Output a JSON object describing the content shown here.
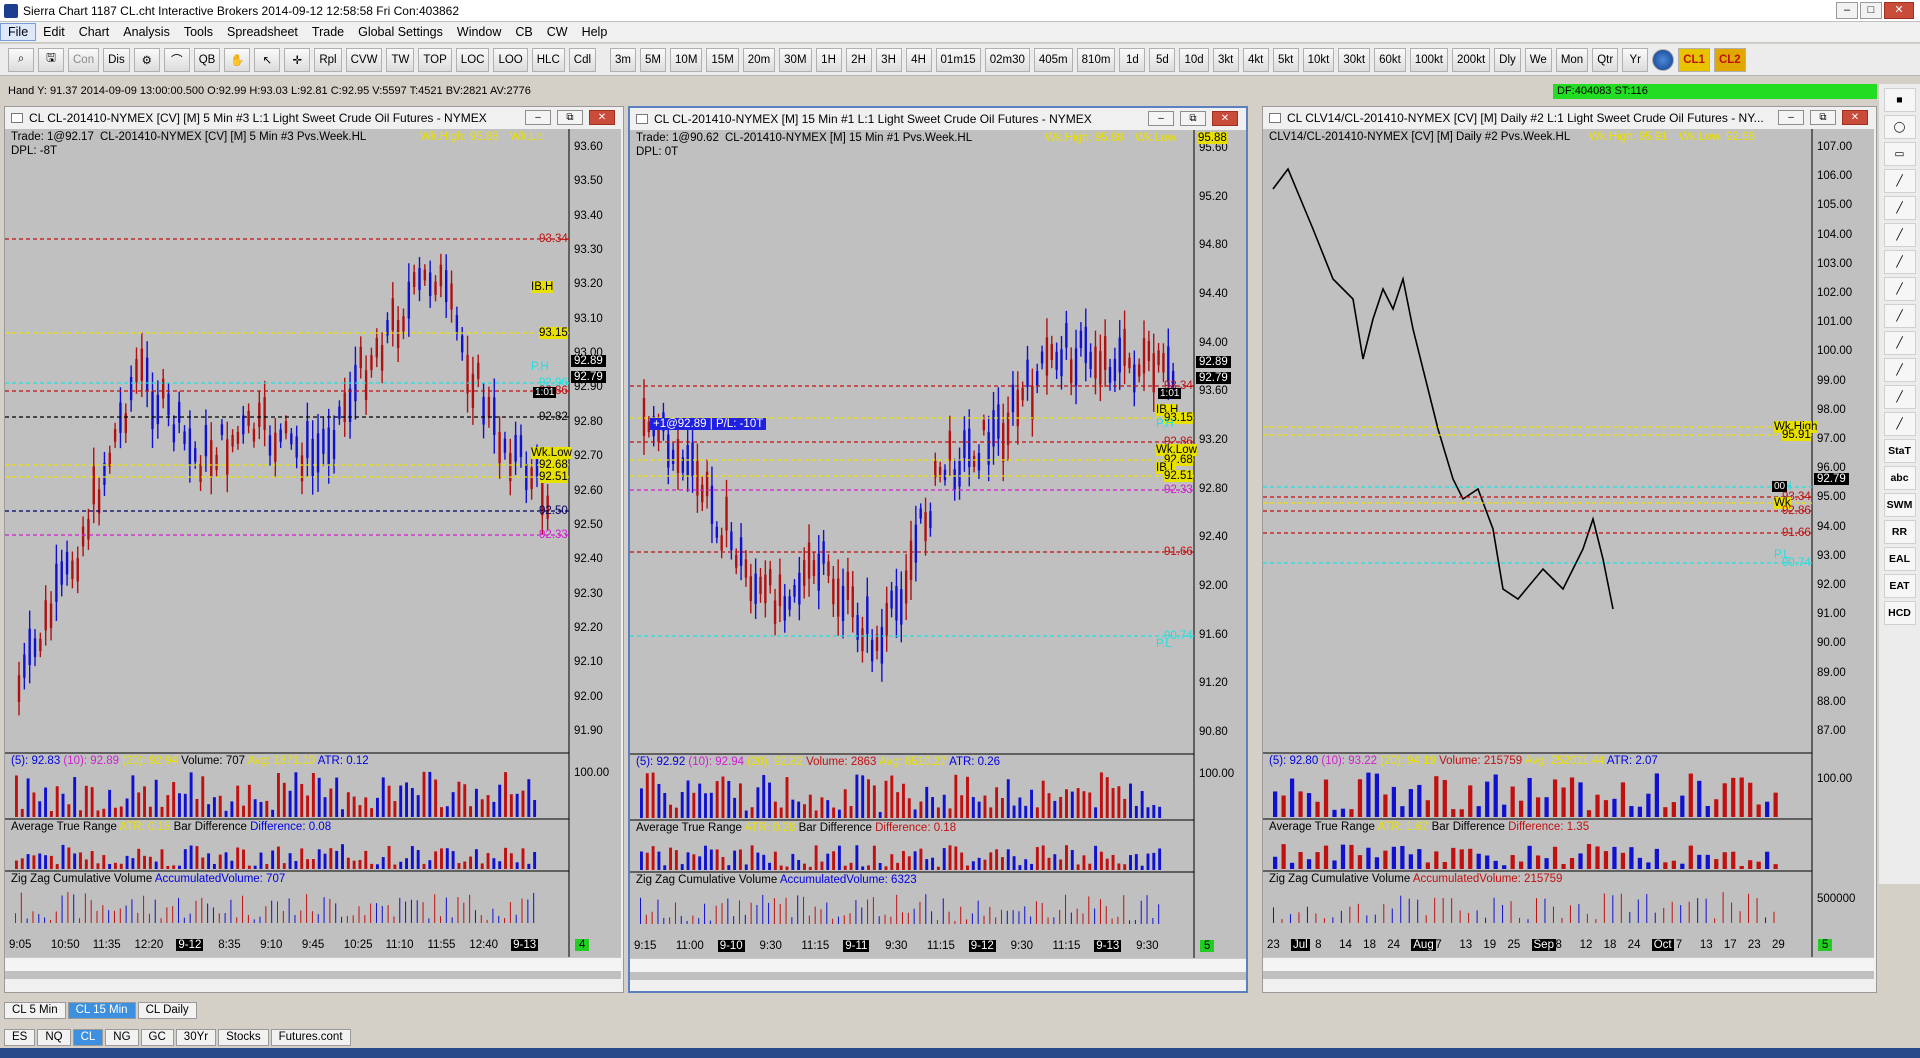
{
  "window": {
    "title": "Sierra Chart 1187 CL.cht  Interactive Brokers 2014-09-12  12:58:58 Fri  Con:403862"
  },
  "menu": [
    "File",
    "Edit",
    "Chart",
    "Analysis",
    "Tools",
    "Spreadsheet",
    "Trade",
    "Global Settings",
    "Window",
    "CB",
    "CW",
    "Help"
  ],
  "toolbar": {
    "left": [
      "Con",
      "Dis",
      "QB",
      "Rpl",
      "CVW",
      "TW",
      "TOP",
      "LOC",
      "LOO",
      "HLC",
      "Cdl"
    ],
    "periods": [
      "3m",
      "5M",
      "10M",
      "15M",
      "20m",
      "30M",
      "1H",
      "2H",
      "3H",
      "4H",
      "01m15",
      "02m30",
      "405m",
      "810m",
      "1d",
      "5d",
      "10d",
      "3kt",
      "4kt",
      "5kt",
      "10kt",
      "30kt",
      "60kt",
      "100kt",
      "200kt",
      "Dly",
      "We",
      "Mon",
      "Qtr",
      "Yr"
    ],
    "cl1": "CL1",
    "cl2": "CL2"
  },
  "status_line": "Hand Y: 91.37  2014-09-09  13:00:00.500  O:92.99  H:93.03  L:92.81  C:92.95  V:5597  T:4521  BV:2821  AV:2776",
  "df_box": "DF:404083  ST:116",
  "charts": [
    {
      "id": "c1",
      "win_title": "CL  CL-201410-NYMEX [CV] [M]  5 Min  #3  L:1  Light Sweet Crude Oil Futures - NYMEX",
      "header": "CL-201410-NYMEX [CV] [M]  5 Min  #3  Pvs.Week.HL",
      "trade": "Trade: 1@92.17",
      "dpl": "DPL: -8T",
      "wkhigh": "Wk.High: 95.88",
      "wklow_hdr": "Wk.Lo",
      "price_axis": [
        "93.60",
        "93.50",
        "93.40",
        "93.30",
        "93.20",
        "93.10",
        "93.00",
        "92.90",
        "92.80",
        "92.70",
        "92.60",
        "92.50",
        "92.40",
        "92.30",
        "92.20",
        "92.10",
        "92.00",
        "91.90"
      ],
      "levels": [
        {
          "t": "93.34",
          "c": "#c01010"
        },
        {
          "t": "IB.H",
          "c": "#e8e000"
        },
        {
          "t": "93.15",
          "c": "#e8e000"
        },
        {
          "t": "P.H",
          "c": "#20e0e0"
        },
        {
          "t": "92.96",
          "c": "#20e0e0"
        },
        {
          "t": "92.86",
          "c": "#c01010"
        },
        {
          "t": "92.82",
          "c": "#000"
        },
        {
          "t": "Wk.Low",
          "c": "#e8e000"
        },
        {
          "t": "92.68",
          "c": "#e8e000"
        },
        {
          "t": "92.51",
          "c": "#e8e000"
        },
        {
          "t": "92.50",
          "c": "#000060"
        },
        {
          "t": "92.33",
          "c": "#d020d0"
        }
      ],
      "price_boxes": [
        "92.89",
        "92.79"
      ],
      "timer": "1:01",
      "study1": [
        {
          "t": "(5): 92.83",
          "c": "#0000e0"
        },
        {
          "t": "(10): 92.89",
          "c": "#d020d0"
        },
        {
          "t": "(20): 92.94",
          "c": "#e8e000"
        },
        {
          "t": "Volume: 707",
          "c": "#000"
        },
        {
          "t": "Avg: 1871.10",
          "c": "#e8e000"
        },
        {
          "t": "ATR: 0.12",
          "c": "#0000e0"
        }
      ],
      "vol_axis": "100.00",
      "study2": [
        {
          "t": "Average True Range",
          "c": "#000"
        },
        {
          "t": "ATR: 0.15",
          "c": "#e8e000"
        },
        {
          "t": "Bar Difference",
          "c": "#000"
        },
        {
          "t": "Difference: 0.08",
          "c": "#0000e0"
        }
      ],
      "study3": [
        {
          "t": "Zig Zag Cumulative Volume",
          "c": "#000"
        },
        {
          "t": "AccumulatedVolume: 707",
          "c": "#0000e0"
        }
      ],
      "time_axis": [
        "9:05",
        "10:50",
        "11:35",
        "12:20",
        "9-12",
        "8:35",
        "9:10",
        "9:45",
        "10:25",
        "11:10",
        "11:55",
        "12:40",
        "9-13"
      ],
      "corner": "4"
    },
    {
      "id": "c2",
      "win_title": "CL  CL-201410-NYMEX [M]  15 Min  #1  L:1  Light Sweet Crude Oil Futures - NYMEX",
      "header": "CL-201410-NYMEX [M]  15 Min  #1  Pvs.Week.HL",
      "trade": "Trade: 1@90.62",
      "dpl": "DPL: 0T",
      "wkhigh": "Wk.High: 95.88",
      "wklow_hdr": "Wk.Low:",
      "wklow_val": "95.88",
      "price_axis": [
        "95.60",
        "95.20",
        "94.80",
        "94.40",
        "94.00",
        "93.60",
        "93.20",
        "92.80",
        "92.40",
        "92.00",
        "91.60",
        "91.20",
        "90.80"
      ],
      "levels": [
        {
          "t": "93.34",
          "c": "#c01010"
        },
        {
          "t": "IB.H",
          "c": "#e8e000"
        },
        {
          "t": "93.15",
          "c": "#e8e000"
        },
        {
          "t": "P.H",
          "c": "#20e0e0"
        },
        {
          "t": "92.86",
          "c": "#c01010"
        },
        {
          "t": "Wk.Low",
          "c": "#e8e000"
        },
        {
          "t": "92.68",
          "c": "#e8e000"
        },
        {
          "t": "IB.L",
          "c": "#e8e000"
        },
        {
          "t": "92.51",
          "c": "#e8e000"
        },
        {
          "t": "92.33",
          "c": "#d020d0"
        },
        {
          "t": "91.66",
          "c": "#c01010"
        },
        {
          "t": "P.L",
          "c": "#20e0e0"
        },
        {
          "t": "90.74",
          "c": "#20e0e0"
        }
      ],
      "price_boxes": [
        "92.89",
        "92.79"
      ],
      "timer": "1:01",
      "position_label": "+1@92.89 | P/L: -10T",
      "study1": [
        {
          "t": "(5): 92.92",
          "c": "#0000e0"
        },
        {
          "t": "(10): 92.94",
          "c": "#d020d0"
        },
        {
          "t": "(20): 92.82",
          "c": "#e8e000"
        },
        {
          "t": "Volume: 2863",
          "c": "#c01010"
        },
        {
          "t": "Avg: 6510.27",
          "c": "#e8e000"
        },
        {
          "t": "ATR: 0.26",
          "c": "#0000e0"
        }
      ],
      "vol_axis": "100.00",
      "study2": [
        {
          "t": "Average True Range",
          "c": "#000"
        },
        {
          "t": "ATR: 0.28",
          "c": "#e8e000"
        },
        {
          "t": "Bar Difference",
          "c": "#000"
        },
        {
          "t": "Difference: 0.18",
          "c": "#c01010"
        }
      ],
      "study3": [
        {
          "t": "Zig Zag Cumulative Volume",
          "c": "#000"
        },
        {
          "t": "AccumulatedVolume: 6323",
          "c": "#0000e0"
        }
      ],
      "time_axis": [
        "9:15",
        "11:00",
        "9-10",
        "9:30",
        "11:15",
        "9-11",
        "9:30",
        "11:15",
        "9-12",
        "9:30",
        "11:15",
        "9-13",
        "9:30"
      ],
      "corner": "5"
    },
    {
      "id": "c3",
      "win_title": "CL  CLV14/CL-201410-NYMEX [CV] [M]  Daily  #2  L:1  Light Sweet Crude Oil Futures - NY...",
      "header": "CLV14/CL-201410-NYMEX [CV] [M]  Daily  #2  Pvs.Week.HL",
      "wkhigh": "Wk.High: 95.91",
      "wklow_hdr": "Wk.Low: 92.68",
      "price_axis": [
        "107.00",
        "106.00",
        "105.00",
        "104.00",
        "103.00",
        "102.00",
        "101.00",
        "100.00",
        "99.00",
        "98.00",
        "97.00",
        "96.00",
        "95.00",
        "94.00",
        "93.00",
        "92.00",
        "91.00",
        "90.00",
        "89.00",
        "88.00",
        "87.00"
      ],
      "levels": [
        {
          "t": "Wk.High",
          "c": "#e8e000"
        },
        {
          "t": "95.91",
          "c": "#e8e000"
        },
        {
          "t": "P.H",
          "c": "#20e0e0"
        },
        {
          "t": "93.34",
          "c": "#c01010"
        },
        {
          "t": "Wk",
          "c": "#e8e000"
        },
        {
          "t": "92.86",
          "c": "#c01010"
        },
        {
          "t": "91.66",
          "c": "#c01010"
        },
        {
          "t": "P.L",
          "c": "#20e0e0"
        },
        {
          "t": "90.74",
          "c": "#20e0e0"
        }
      ],
      "price_boxes": [
        "92.79"
      ],
      "timer": "00",
      "study1": [
        {
          "t": "(5): 92.80",
          "c": "#0000e0"
        },
        {
          "t": "(10): 93.22",
          "c": "#d020d0"
        },
        {
          "t": "(20): 94.19",
          "c": "#e8e000"
        },
        {
          "t": "Volume: 215759",
          "c": "#c01010"
        },
        {
          "t": "Avg: 252011.44",
          "c": "#e8e000"
        },
        {
          "t": "ATR: 2.07",
          "c": "#0000e0"
        }
      ],
      "vol_axis": "100.00",
      "vol_axis2": "500000",
      "study2": [
        {
          "t": "Average True Range",
          "c": "#000"
        },
        {
          "t": "ATR: 1.67",
          "c": "#e8e000"
        },
        {
          "t": "Bar Difference",
          "c": "#000"
        },
        {
          "t": "Difference: 1.35",
          "c": "#c01010"
        }
      ],
      "study3": [
        {
          "t": "Zig Zag Cumulative Volume",
          "c": "#000"
        },
        {
          "t": "AccumulatedVolume: 215759",
          "c": "#c01010"
        }
      ],
      "time_axis": [
        "23",
        "Jul",
        "8",
        "14",
        "18",
        "24",
        "Aug",
        "7",
        "13",
        "19",
        "25",
        "Sep",
        "8",
        "12",
        "18",
        "24",
        "Oct",
        "7",
        "13",
        "17",
        "23",
        "29"
      ],
      "corner": "5"
    }
  ],
  "right_tools": [
    "StaT",
    "abc",
    "SWM",
    "RR",
    "EAL",
    "EAT",
    "HCD"
  ],
  "bottom_tabs": [
    "CL 5 Min",
    "CL 15 Min",
    "CL Daily"
  ],
  "symbol_tabs": [
    "ES",
    "NQ",
    "CL",
    "NG",
    "GC",
    "30Yr",
    "Stocks",
    "Futures.cont"
  ]
}
